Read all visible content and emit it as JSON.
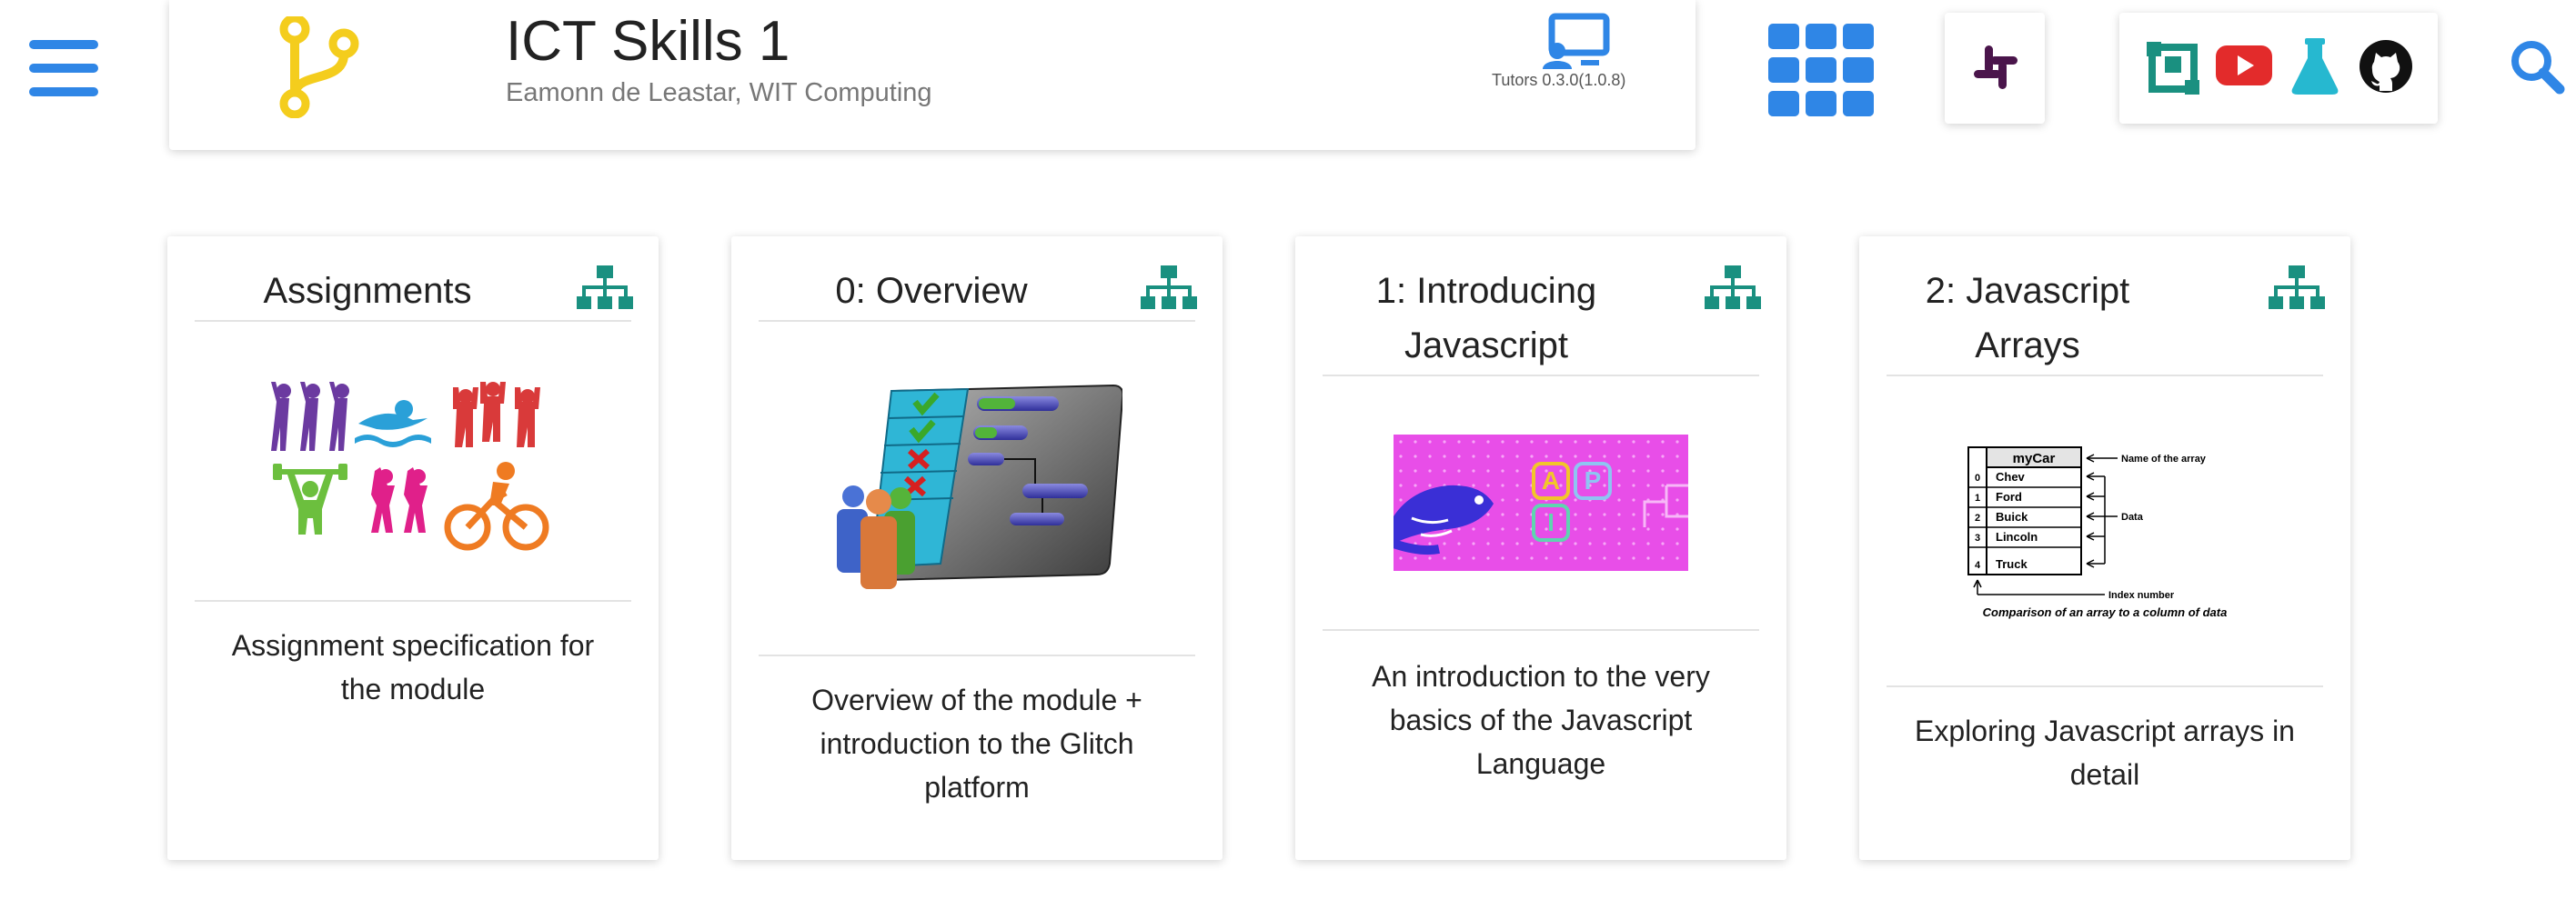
{
  "header": {
    "title": "ICT Skills 1",
    "subtitle": "Eamonn de Leastar, WIT Computing",
    "version": "Tutors 0.3.0(1.0.8)"
  },
  "colors": {
    "accent_blue": "#2f86e6",
    "logo_yellow": "#f4cd1d",
    "teal": "#1a9080",
    "youtube_red": "#e32b2b",
    "lab_cyan": "#26b8d0"
  },
  "icons": {
    "menu": "hamburger-menu-icon",
    "logo": "git-branch-icon",
    "tutors": "desktop-user-icon",
    "apps": "grid-apps-icon",
    "slack": "slack-icon",
    "links": [
      "toc-icon",
      "youtube-icon",
      "flask-icon",
      "github-icon"
    ],
    "search": "search-icon",
    "topic": "sitemap-icon"
  },
  "cards": [
    {
      "title": "Assignments",
      "description": "Assignment specification for the module"
    },
    {
      "title": "0: Overview",
      "description": "Overview of the module + introduction to the Glitch platform"
    },
    {
      "title": "1: Introducing Javascript",
      "description": "An introduction to the very basics of the Javascript Language",
      "image_letters": [
        "A",
        "P",
        "I"
      ]
    },
    {
      "title": "2: Javascript Arrays",
      "description": "Exploring Javascript arrays in detail",
      "image": {
        "header": "myCar",
        "rows": [
          {
            "index": "0",
            "value": "Chev"
          },
          {
            "index": "1",
            "value": "Ford"
          },
          {
            "index": "2",
            "value": "Buick"
          },
          {
            "index": "3",
            "value": "Lincoln"
          },
          {
            "index": "4",
            "value": "Truck"
          }
        ],
        "label_name": "Name of the array",
        "label_data": "Data",
        "label_index": "Index number",
        "caption": "Comparison of an array to a column of data"
      }
    }
  ]
}
